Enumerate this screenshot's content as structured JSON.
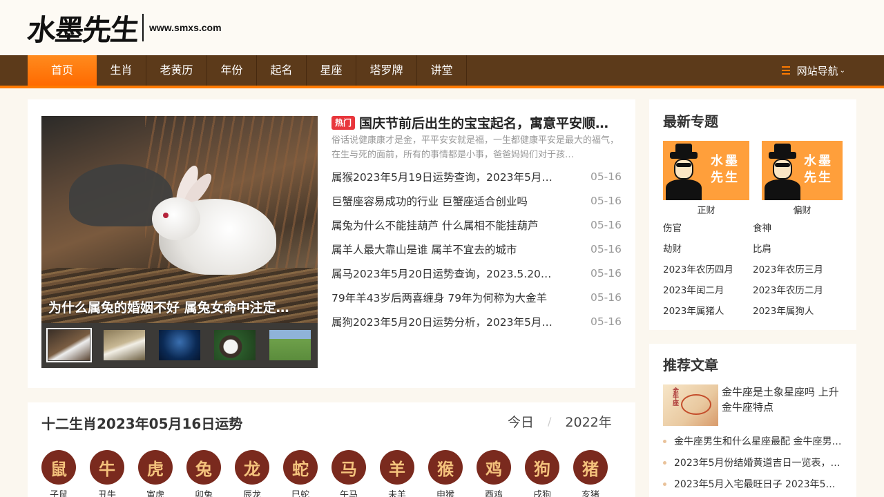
{
  "header": {
    "logo_text": "水墨先生",
    "site_url": "www.smxs.com"
  },
  "nav": {
    "items": [
      "首页",
      "生肖",
      "老黄历",
      "年份",
      "起名",
      "星座",
      "塔罗牌",
      "讲堂"
    ],
    "site_nav_label": "网站导航",
    "accent_color": "#ff7a00",
    "bar_color": "#5c3a1a"
  },
  "featured": {
    "slide_caption": "为什么属兔的婚姻不好 属兔女命中注定…",
    "hot_badge": "热门",
    "headline": "国庆节前后出生的宝宝起名，寓意平安顺…",
    "summary": "俗话说健康康才是金，平平安安就是福，一生都健康平安是最大的福气，在生与死的面前，所有的事情都是小事，爸爸妈妈们对于孩…",
    "news": [
      {
        "title": "属猴2023年5月19日运势查询，2023年5月…",
        "date": "05-16"
      },
      {
        "title": "巨蟹座容易成功的行业 巨蟹座适合创业吗",
        "date": "05-16"
      },
      {
        "title": "属兔为什么不能挂葫芦 什么属相不能挂葫芦",
        "date": "05-16"
      },
      {
        "title": "属羊人最大靠山是谁 属羊不宜去的城市",
        "date": "05-16"
      },
      {
        "title": "属马2023年5月20日运势查询，2023.5.20…",
        "date": "05-16"
      },
      {
        "title": "79年羊43岁后两喜缠身 79年为何称为大金羊",
        "date": "05-16"
      },
      {
        "title": "属狗2023年5月20日运势分析，2023年5月…",
        "date": "05-16"
      }
    ]
  },
  "sidebar": {
    "topics_title": "最新专题",
    "topic_cards": [
      {
        "seal": "水墨先生",
        "label": "正财"
      },
      {
        "seal": "水墨先生",
        "label": "偏财"
      }
    ],
    "tags": [
      "伤官",
      "食神",
      "劫财",
      "比肩",
      "2023年农历四月",
      "2023年农历三月",
      "2023年闰二月",
      "2023年农历二月",
      "2023年属猪人",
      "2023年属狗人"
    ],
    "recommend_title": "推荐文章",
    "recommend_feature": "金牛座是土象星座吗 上升金牛座特点",
    "recommend_feature_img_text": "金牛座",
    "recommend_list": [
      "金牛座男生和什么星座最配 金牛座男…",
      "2023年5月份结婚黄道吉日一览表，…",
      "2023年5月入宅最旺日子 2023年5月…"
    ]
  },
  "zodiac": {
    "title": "十二生肖2023年05月16日运势",
    "tab_today": "今日",
    "tab_year": "2022年",
    "animals": [
      {
        "name": "子鼠",
        "glyph": "鼠"
      },
      {
        "name": "丑牛",
        "glyph": "牛"
      },
      {
        "name": "寅虎",
        "glyph": "虎"
      },
      {
        "name": "卯兔",
        "glyph": "兔"
      },
      {
        "name": "辰龙",
        "glyph": "龙"
      },
      {
        "name": "巳蛇",
        "glyph": "蛇"
      },
      {
        "name": "午马",
        "glyph": "马"
      },
      {
        "name": "未羊",
        "glyph": "羊"
      },
      {
        "name": "申猴",
        "glyph": "猴"
      },
      {
        "name": "酉鸡",
        "glyph": "鸡"
      },
      {
        "name": "戌狗",
        "glyph": "狗"
      },
      {
        "name": "亥猪",
        "glyph": "猪"
      }
    ]
  }
}
